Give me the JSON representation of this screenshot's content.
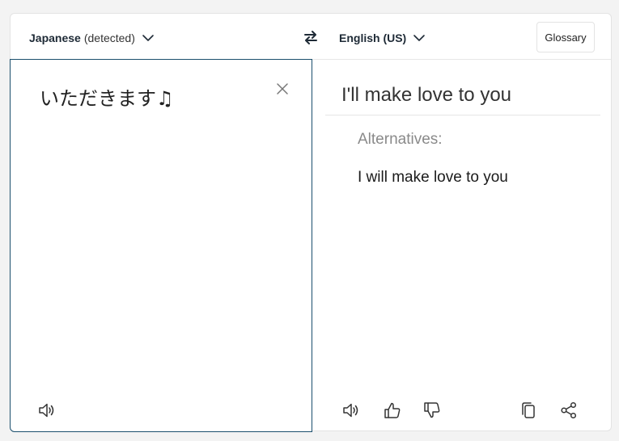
{
  "header": {
    "source_language": "Japanese",
    "source_detected": "(detected)",
    "target_language": "English (US)",
    "glossary_label": "Glossary"
  },
  "source": {
    "text": "いただきます♫"
  },
  "target": {
    "translation": "I'll make love to you",
    "alternatives_label": "Alternatives:",
    "alternatives": [
      "I will make love to you"
    ]
  },
  "icons": {
    "chevron": "chevron-down-icon",
    "swap": "swap-arrows-icon",
    "clear": "close-icon",
    "speaker": "speaker-icon",
    "thumbs_up": "thumbs-up-icon",
    "thumbs_down": "thumbs-down-icon",
    "copy": "copy-icon",
    "share": "share-icon"
  },
  "colors": {
    "accent_border": "#1b4f6d",
    "text_dark": "#1e2a36",
    "muted": "#8a8a8a"
  }
}
